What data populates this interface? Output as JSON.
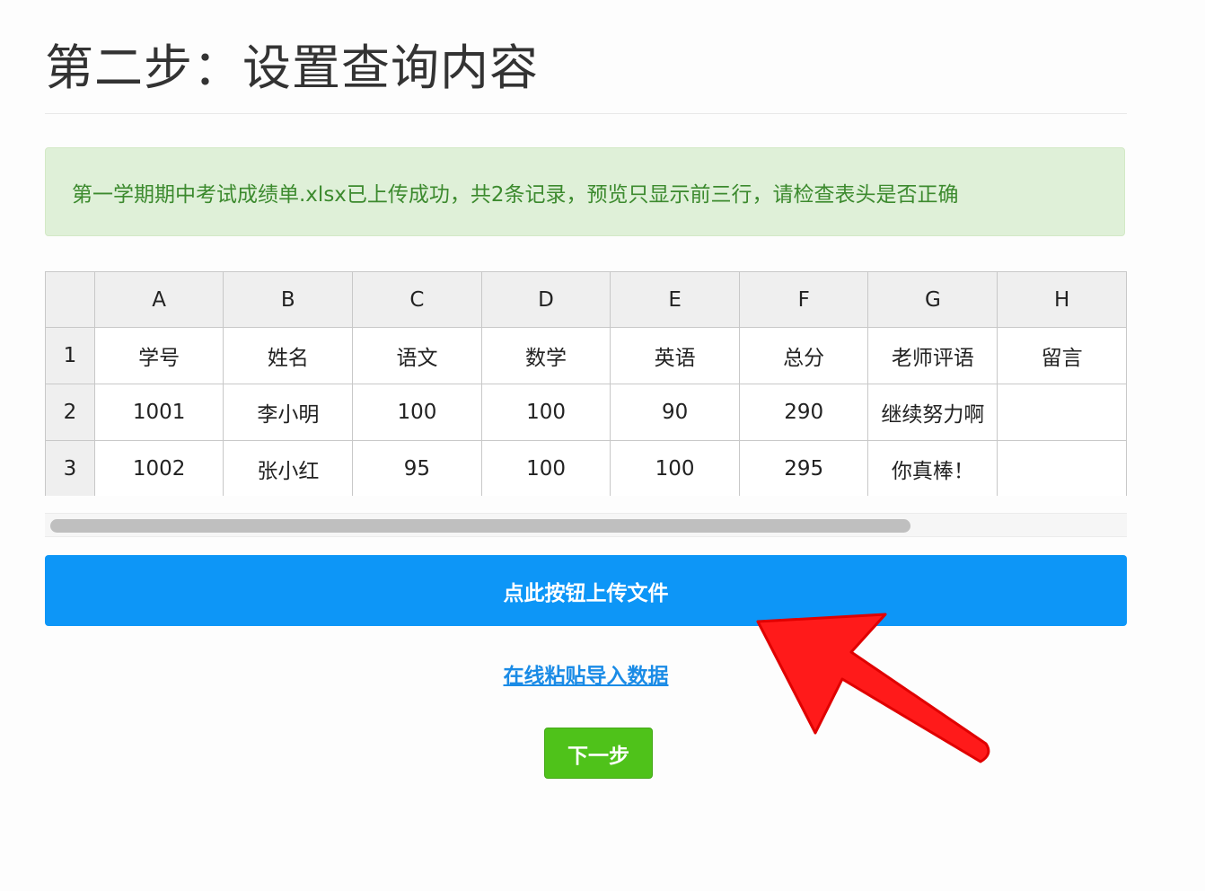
{
  "page": {
    "title": "第二步：设置查询内容"
  },
  "alert": {
    "message": "第一学期期中考试成绩单.xlsx已上传成功，共2条记录，预览只显示前三行，请检查表头是否正确"
  },
  "sheet": {
    "column_letters": [
      "A",
      "B",
      "C",
      "D",
      "E",
      "F",
      "G",
      "H"
    ],
    "row_numbers": [
      "1",
      "2",
      "3"
    ],
    "rows": [
      [
        "学号",
        "姓名",
        "语文",
        "数学",
        "英语",
        "总分",
        "老师评语",
        "留言"
      ],
      [
        "1001",
        "李小明",
        "100",
        "100",
        "90",
        "290",
        "继续努力啊",
        ""
      ],
      [
        "1002",
        "张小红",
        "95",
        "100",
        "100",
        "295",
        "你真棒！",
        ""
      ]
    ]
  },
  "actions": {
    "upload_label": "点此按钮上传文件",
    "paste_label": "在线粘贴导入数据",
    "next_label": "下一步"
  },
  "annotation": {
    "arrow_color": "#ff1a1a"
  },
  "colors": {
    "primary": "#0d96f7",
    "success": "#4fc21a",
    "alert_bg": "#dff0d8",
    "alert_text": "#3c8a2e"
  }
}
